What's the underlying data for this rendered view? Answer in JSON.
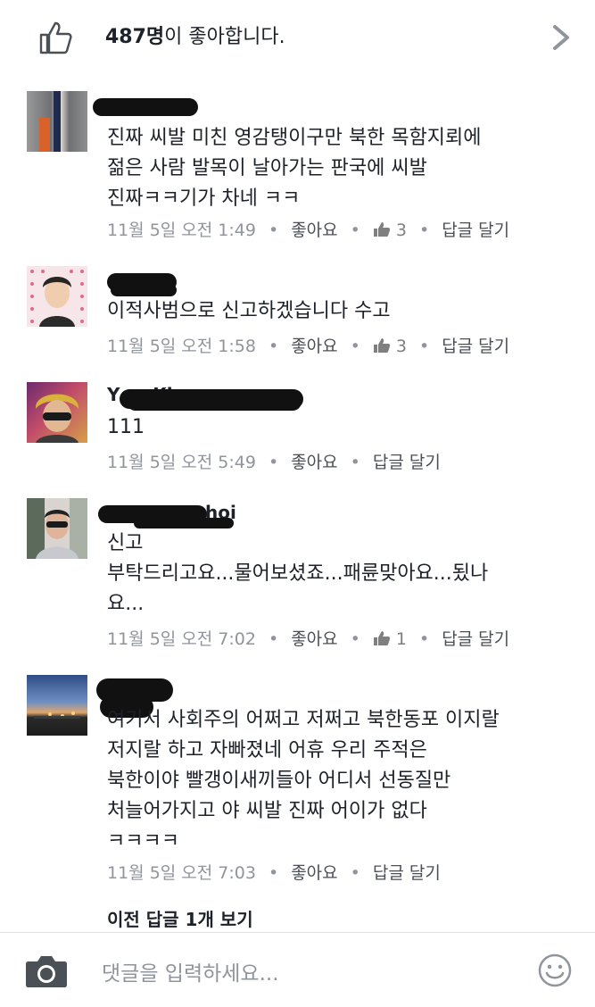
{
  "likes_bar": {
    "count": "487명",
    "suffix": "이 좋아합니다."
  },
  "comments": [
    {
      "body": "진짜 씨발 미친 영감탱이구만 북한 목함지뢰에\n젊은 사람 발목이 날아가는 판국에 씨발\n진짜ㅋㅋ기가 차네 ㅋㅋ",
      "time": "11월 5일 오전 1:49",
      "like": "좋아요",
      "like_count": "3",
      "reply": "답글 달기"
    },
    {
      "body": "이적사범으로 신고하겠습니다 수고",
      "time": "11월 5일 오전 1:58",
      "like": "좋아요",
      "like_count": "3",
      "reply": "답글 달기"
    },
    {
      "name_fragment": "Y   ...   Kim",
      "body": "111",
      "time": "11월 5일 오전 5:49",
      "like": "좋아요",
      "reply": "답글 달기"
    },
    {
      "name_fragment": "hoi",
      "body": "신고\n부탁드리고요...물어보셨죠...패륜맞아요...됬나\n요...",
      "time": "11월 5일 오전 7:02",
      "like": "좋아요",
      "like_count": "1",
      "reply": "답글 달기"
    },
    {
      "body": "여기서 사회주의 어쩌고 저쩌고 북한동포 이지랄\n저지랄 하고 자빠졌네 어휴 우리 주적은\n북한이야 빨갱이새끼들아 어디서 선동질만\n처늘어가지고 야 씨발 진짜 어이가 없다\nㅋㅋㅋㅋ",
      "time": "11월 5일 오전 7:03",
      "like": "좋아요",
      "reply": "답글 달기"
    }
  ],
  "view_previous": "이전 답글 1개 보기",
  "composer": {
    "placeholder": "댓글을 입력하세요..."
  },
  "colors": {
    "text": "#1d2129",
    "meta": "#90949c",
    "action": "#4b4f56",
    "divider": "#dddfe2"
  }
}
